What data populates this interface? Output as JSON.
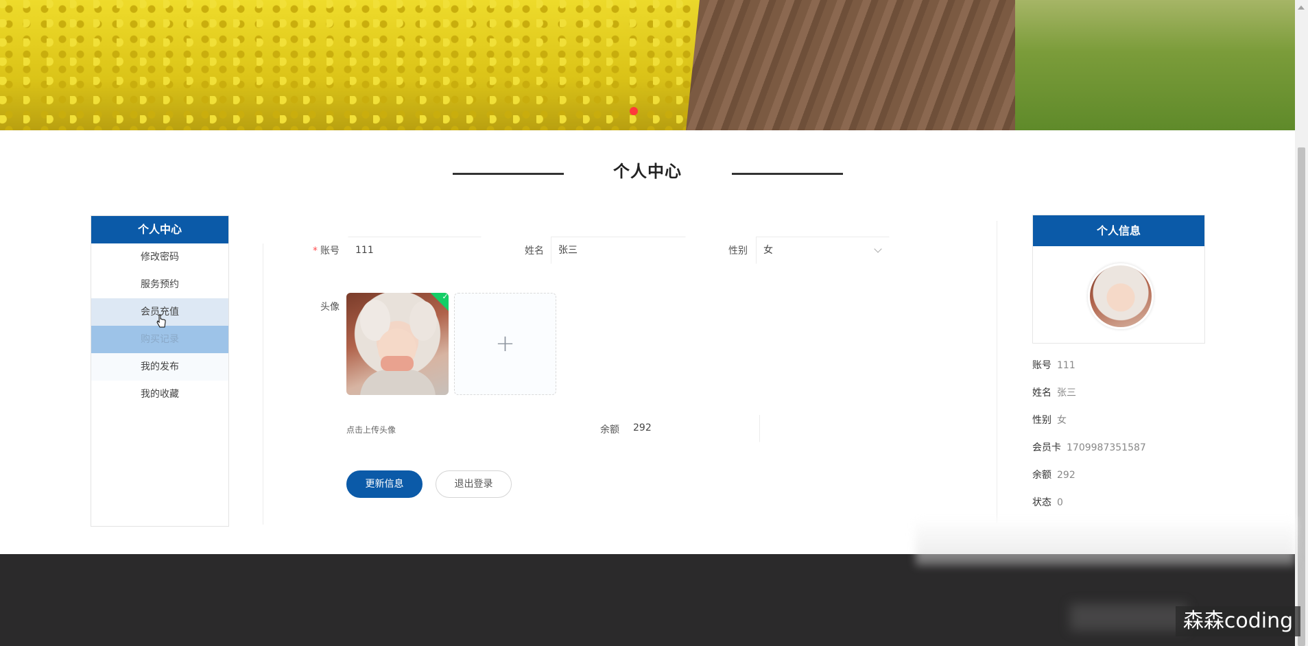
{
  "section": {
    "title": "个人中心"
  },
  "sidebar": {
    "title": "个人中心",
    "items": [
      {
        "label": "修改密码"
      },
      {
        "label": "服务预约"
      },
      {
        "label": "会员充值"
      },
      {
        "label": "购买记录"
      },
      {
        "label": "我的发布"
      },
      {
        "label": "我的收藏"
      }
    ]
  },
  "form": {
    "account_label": "账号",
    "account_value": "111",
    "name_label": "姓名",
    "name_value": "张三",
    "gender_label": "性别",
    "gender_value": "女",
    "avatar_label": "头像",
    "upload_tip": "点击上传头像",
    "balance_label": "余额",
    "balance_value": "292",
    "update_button": "更新信息",
    "logout_button": "退出登录"
  },
  "profile_card": {
    "title": "个人信息",
    "rows": [
      {
        "key": "账号",
        "value": "111"
      },
      {
        "key": "姓名",
        "value": "张三"
      },
      {
        "key": "性别",
        "value": "女"
      },
      {
        "key": "会员卡",
        "value": "1709987351587"
      },
      {
        "key": "余额",
        "value": "292"
      },
      {
        "key": "状态",
        "value": "0"
      }
    ]
  },
  "watermark": "森森coding",
  "colors": {
    "primary": "#0b5aa8",
    "footer": "#2b2a2b"
  },
  "icons": [
    "plus-icon",
    "check-icon",
    "chevron-down-icon",
    "pointer-cursor-icon"
  ]
}
